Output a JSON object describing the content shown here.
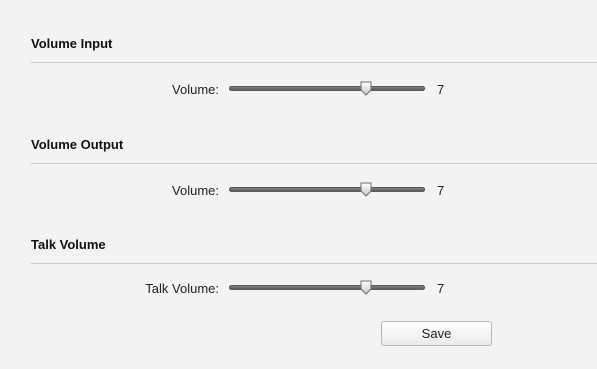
{
  "sections": [
    {
      "title": "Volume Input",
      "row": {
        "label": "Volume:",
        "value": "7",
        "level": 0.7
      }
    },
    {
      "title": "Volume Output",
      "row": {
        "label": "Volume:",
        "value": "7",
        "level": 0.7
      }
    },
    {
      "title": "Talk Volume",
      "row": {
        "label": "Talk Volume:",
        "value": "7",
        "level": 0.7
      }
    }
  ],
  "save_label": "Save"
}
